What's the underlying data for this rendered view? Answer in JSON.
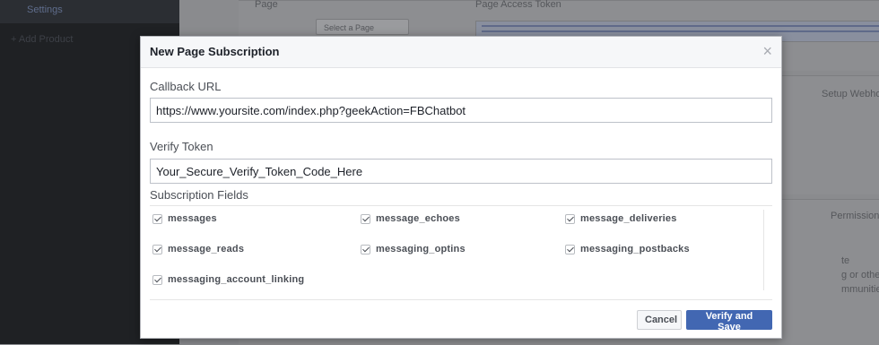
{
  "background": {
    "sidebar": {
      "active_item": "Settings",
      "add_item": "+ Add Product"
    },
    "main": {
      "page_label": "Page",
      "page_select": "Select a Page",
      "token_label": "Page Access Token",
      "webhooks_text": "Setup Webhooks",
      "permissions_text": "Permissions",
      "side_text_1": "te",
      "side_text_2": "g or other",
      "side_text_3": "mmunities."
    }
  },
  "dialog": {
    "title": "New Page Subscription",
    "close_icon": "close-icon",
    "callback_url": {
      "label": "Callback URL",
      "value": "https://www.yoursite.com/index.php?geekAction=FBChatbot"
    },
    "verify_token": {
      "label": "Verify Token",
      "value": "Your_Secure_Verify_Token_Code_Here"
    },
    "subscription_fields": {
      "label": "Subscription Fields",
      "items": [
        {
          "label": "messages",
          "checked": true
        },
        {
          "label": "message_echoes",
          "checked": true
        },
        {
          "label": "message_deliveries",
          "checked": true
        },
        {
          "label": "message_reads",
          "checked": true
        },
        {
          "label": "messaging_optins",
          "checked": true
        },
        {
          "label": "messaging_postbacks",
          "checked": true
        },
        {
          "label": "messaging_account_linking",
          "checked": true
        }
      ]
    },
    "buttons": {
      "cancel_label": "Cancel",
      "submit_label": "Verify and Save"
    }
  },
  "colors": {
    "primary": "#4267b2",
    "overlay": "#8b8d91",
    "dialog_header": "#f6f7f9"
  }
}
